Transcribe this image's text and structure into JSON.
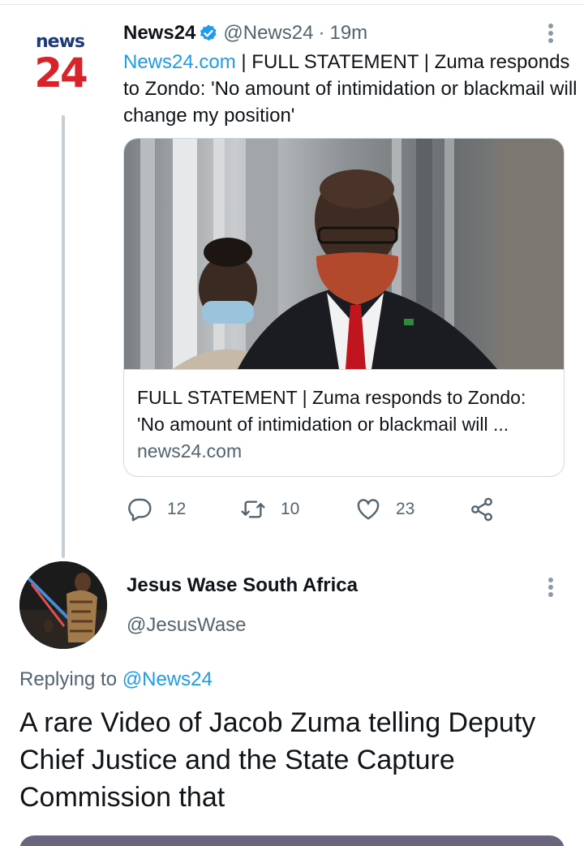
{
  "tweet1": {
    "logo": {
      "line1": "news",
      "line2": "24"
    },
    "display_name": "News24",
    "handle": "@News24",
    "separator": "·",
    "time": "19m",
    "text_link": "News24.com",
    "text_rest": " | FULL STATEMENT | Zuma responds to Zondo: 'No amount of intimidation or blackmail will change my position'",
    "card": {
      "title_line1": "FULL STATEMENT | Zuma responds to Zondo:",
      "title_line2": "'No amount of intimidation or blackmail will ...",
      "domain": "news24.com"
    },
    "actions": {
      "replies": "12",
      "retweets": "10",
      "likes": "23"
    }
  },
  "tweet2": {
    "display_name": "Jesus Wase South Africa",
    "handle": "@JesusWase",
    "replying_prefix": "Replying to ",
    "replying_to": "@News24",
    "text": "A rare Video of Jacob Zuma telling Deputy Chief Justice and the State Capture Commission that"
  },
  "colors": {
    "accent": "#1d9bf0",
    "secondary_text": "#536471",
    "brand_red": "#d9232a",
    "brand_blue": "#1d3a78"
  },
  "icons": [
    "verified-badge-icon",
    "more-options-icon",
    "reply-icon",
    "retweet-icon",
    "like-icon",
    "share-icon"
  ]
}
